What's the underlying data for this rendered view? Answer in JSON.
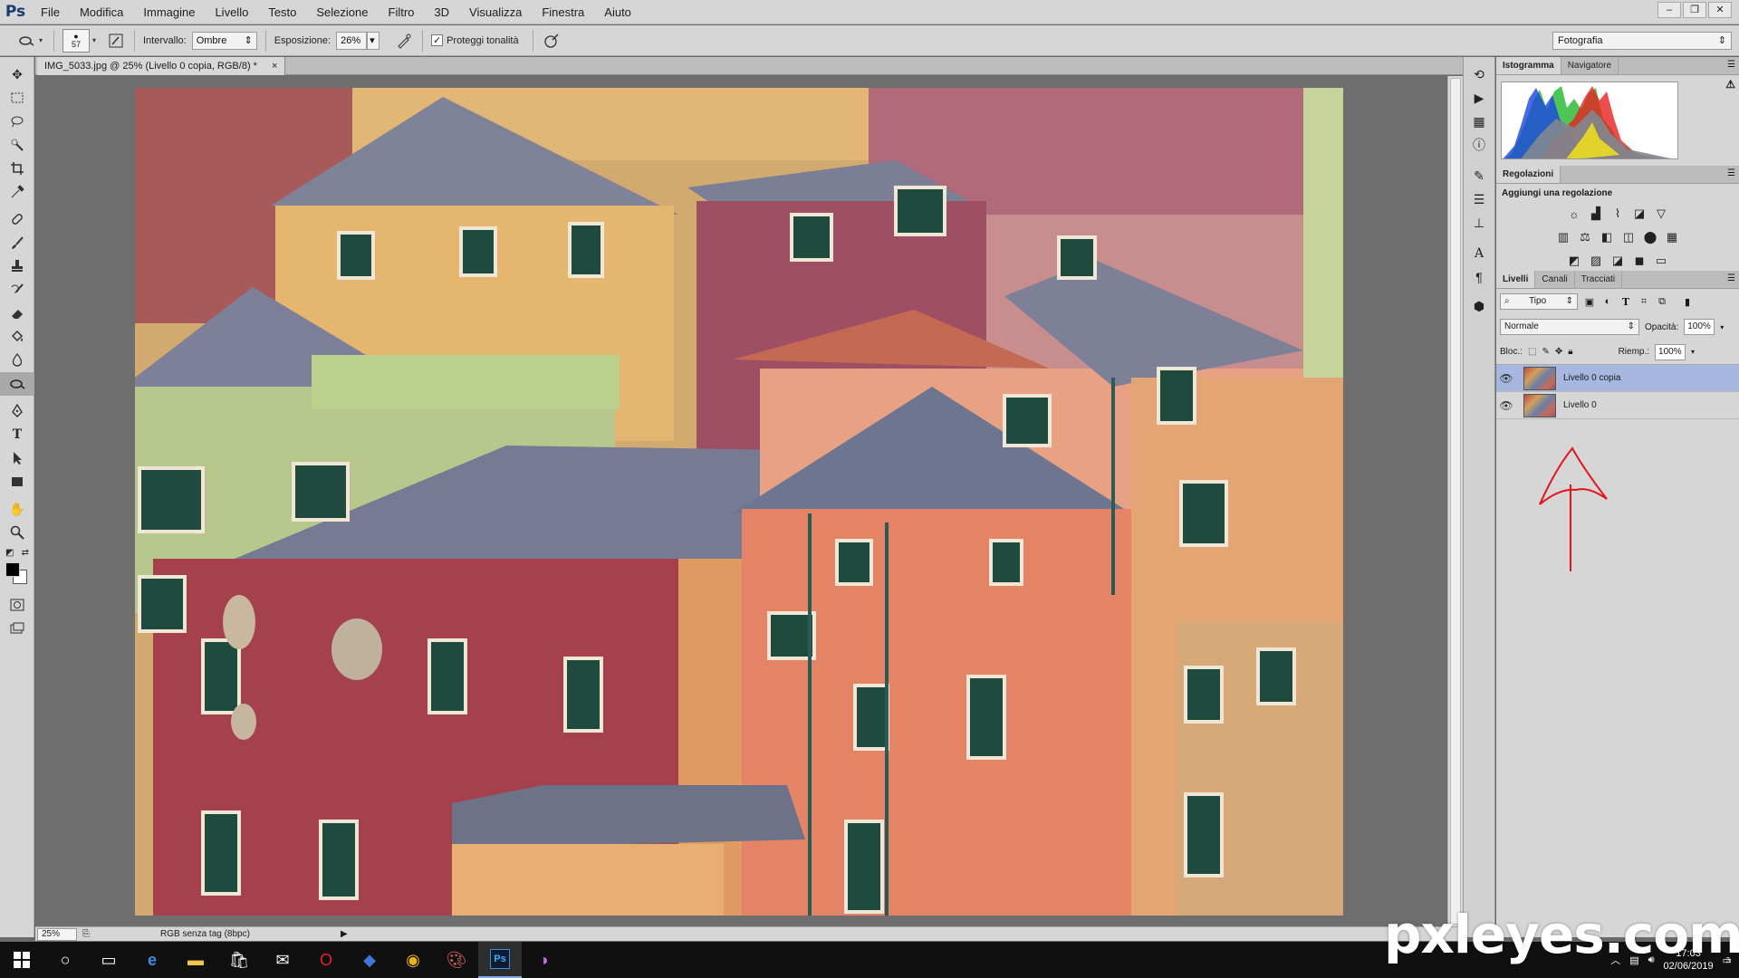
{
  "app": {
    "name": "Ps"
  },
  "menu": [
    "File",
    "Modifica",
    "Immagine",
    "Livello",
    "Testo",
    "Selezione",
    "Filtro",
    "3D",
    "Visualizza",
    "Finestra",
    "Aiuto"
  ],
  "window_controls": {
    "minimize": "–",
    "restore": "❐",
    "close": "✕"
  },
  "options": {
    "brush_size": "57",
    "range_label": "Intervallo:",
    "range_value": "Ombre",
    "exposure_label": "Esposizione:",
    "exposure_value": "26%",
    "protect_tones_label": "Proteggi tonalità",
    "protect_tones_checked": true
  },
  "workspace": {
    "value": "Fotografia"
  },
  "document": {
    "tab_title": "IMG_5033.jpg @ 25% (Livello 0 copia, RGB/8) *",
    "close": "×"
  },
  "status": {
    "zoom": "25%",
    "info": "RGB senza tag (8bpc)"
  },
  "panels": {
    "top_tabs": [
      "Istogramma",
      "Navigatore"
    ],
    "adjustments_tab": "Regolazioni",
    "adjustments_title": "Aggiungi una regolazione",
    "layers_tabs": [
      "Livelli",
      "Canali",
      "Tracciati"
    ],
    "filter_kind": "Tipo",
    "blend_mode": "Normale",
    "opacity_label": "Opacità:",
    "opacity_value": "100%",
    "lock_label": "Bloc.:",
    "fill_label": "Riemp.:",
    "fill_value": "100%",
    "layers": [
      {
        "name": "Livello 0 copia",
        "selected": true,
        "visible": true
      },
      {
        "name": "Livello 0",
        "selected": false,
        "visible": true
      }
    ]
  },
  "taskbar": {
    "date": "02/06/2019",
    "time": "17:03",
    "notifications": "3"
  },
  "watermark": "pxleyes.com",
  "colors": {
    "accent_selection": "#a6b8e0",
    "annotation_arrow": "#e0161b",
    "ps_blue": "#1a3c6e"
  }
}
